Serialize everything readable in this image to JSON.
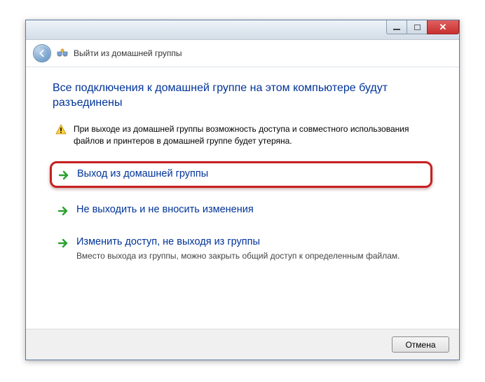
{
  "window": {
    "title": "Выйти из домашней группы"
  },
  "content": {
    "heading": "Все подключения к домашней группе на этом компьютере будут разъединены",
    "warning": "При выходе из домашней группы возможность доступа и совместного использования файлов и принтеров в домашней группе будет утеряна."
  },
  "options": {
    "leave": {
      "title": "Выход из домашней группы"
    },
    "stay": {
      "title": "Не выходить и не вносить изменения"
    },
    "change": {
      "title": "Изменить доступ, не выходя из группы",
      "desc": "Вместо выхода из группы, можно закрыть общий доступ к определенным файлам."
    }
  },
  "footer": {
    "cancel": "Отмена"
  }
}
